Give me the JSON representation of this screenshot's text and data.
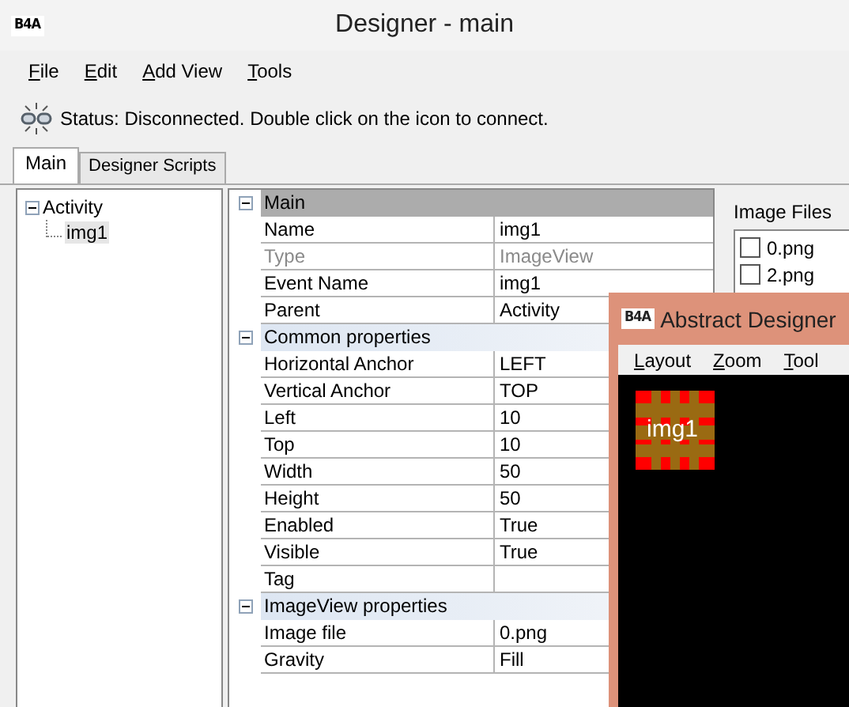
{
  "window": {
    "app_icon": "B4A",
    "title": "Designer - main"
  },
  "menu": [
    "File",
    "Edit",
    "Add View",
    "Tools"
  ],
  "status": "Status: Disconnected. Double click on the icon to connect.",
  "tabs": [
    {
      "label": "Main",
      "selected": true
    },
    {
      "label": "Designer Scripts",
      "selected": false
    }
  ],
  "tree": [
    {
      "label": "Activity",
      "expanded": true,
      "selected": false,
      "children": [
        {
          "label": "img1",
          "selected": true
        }
      ]
    }
  ],
  "property_grid": [
    {
      "title": "Main",
      "expanded": true,
      "selected": true,
      "rows": [
        {
          "name": "Name",
          "value": "img1",
          "disabled": false
        },
        {
          "name": "Type",
          "value": "ImageView",
          "disabled": true
        },
        {
          "name": "Event Name",
          "value": "img1",
          "disabled": false
        },
        {
          "name": "Parent",
          "value": "Activity",
          "disabled": false
        }
      ]
    },
    {
      "title": "Common properties",
      "expanded": true,
      "selected": false,
      "rows": [
        {
          "name": "Horizontal Anchor",
          "value": "LEFT",
          "disabled": false
        },
        {
          "name": "Vertical Anchor",
          "value": "TOP",
          "disabled": false
        },
        {
          "name": "Left",
          "value": "10",
          "disabled": false
        },
        {
          "name": "Top",
          "value": "10",
          "disabled": false
        },
        {
          "name": "Width",
          "value": "50",
          "disabled": false
        },
        {
          "name": "Height",
          "value": "50",
          "disabled": false
        },
        {
          "name": "Enabled",
          "value": "True",
          "disabled": false
        },
        {
          "name": "Visible",
          "value": "True",
          "disabled": false
        },
        {
          "name": "Tag",
          "value": null,
          "disabled": false
        }
      ]
    },
    {
      "title": "ImageView properties",
      "expanded": true,
      "selected": false,
      "rows": [
        {
          "name": "Image file",
          "value": "0.png",
          "disabled": false
        },
        {
          "name": "Gravity",
          "value": "Fill",
          "disabled": false
        }
      ]
    }
  ],
  "image_files": {
    "title": "Image Files",
    "items": [
      {
        "label": "0.png",
        "checked": false
      },
      {
        "label": "2.png",
        "checked": false
      }
    ]
  },
  "abstract_designer": {
    "app_icon": "B4A",
    "title": "Abstract Designer",
    "menu": [
      "Layout",
      "Zoom",
      "Tool"
    ],
    "views": [
      {
        "label": "img1"
      }
    ]
  }
}
